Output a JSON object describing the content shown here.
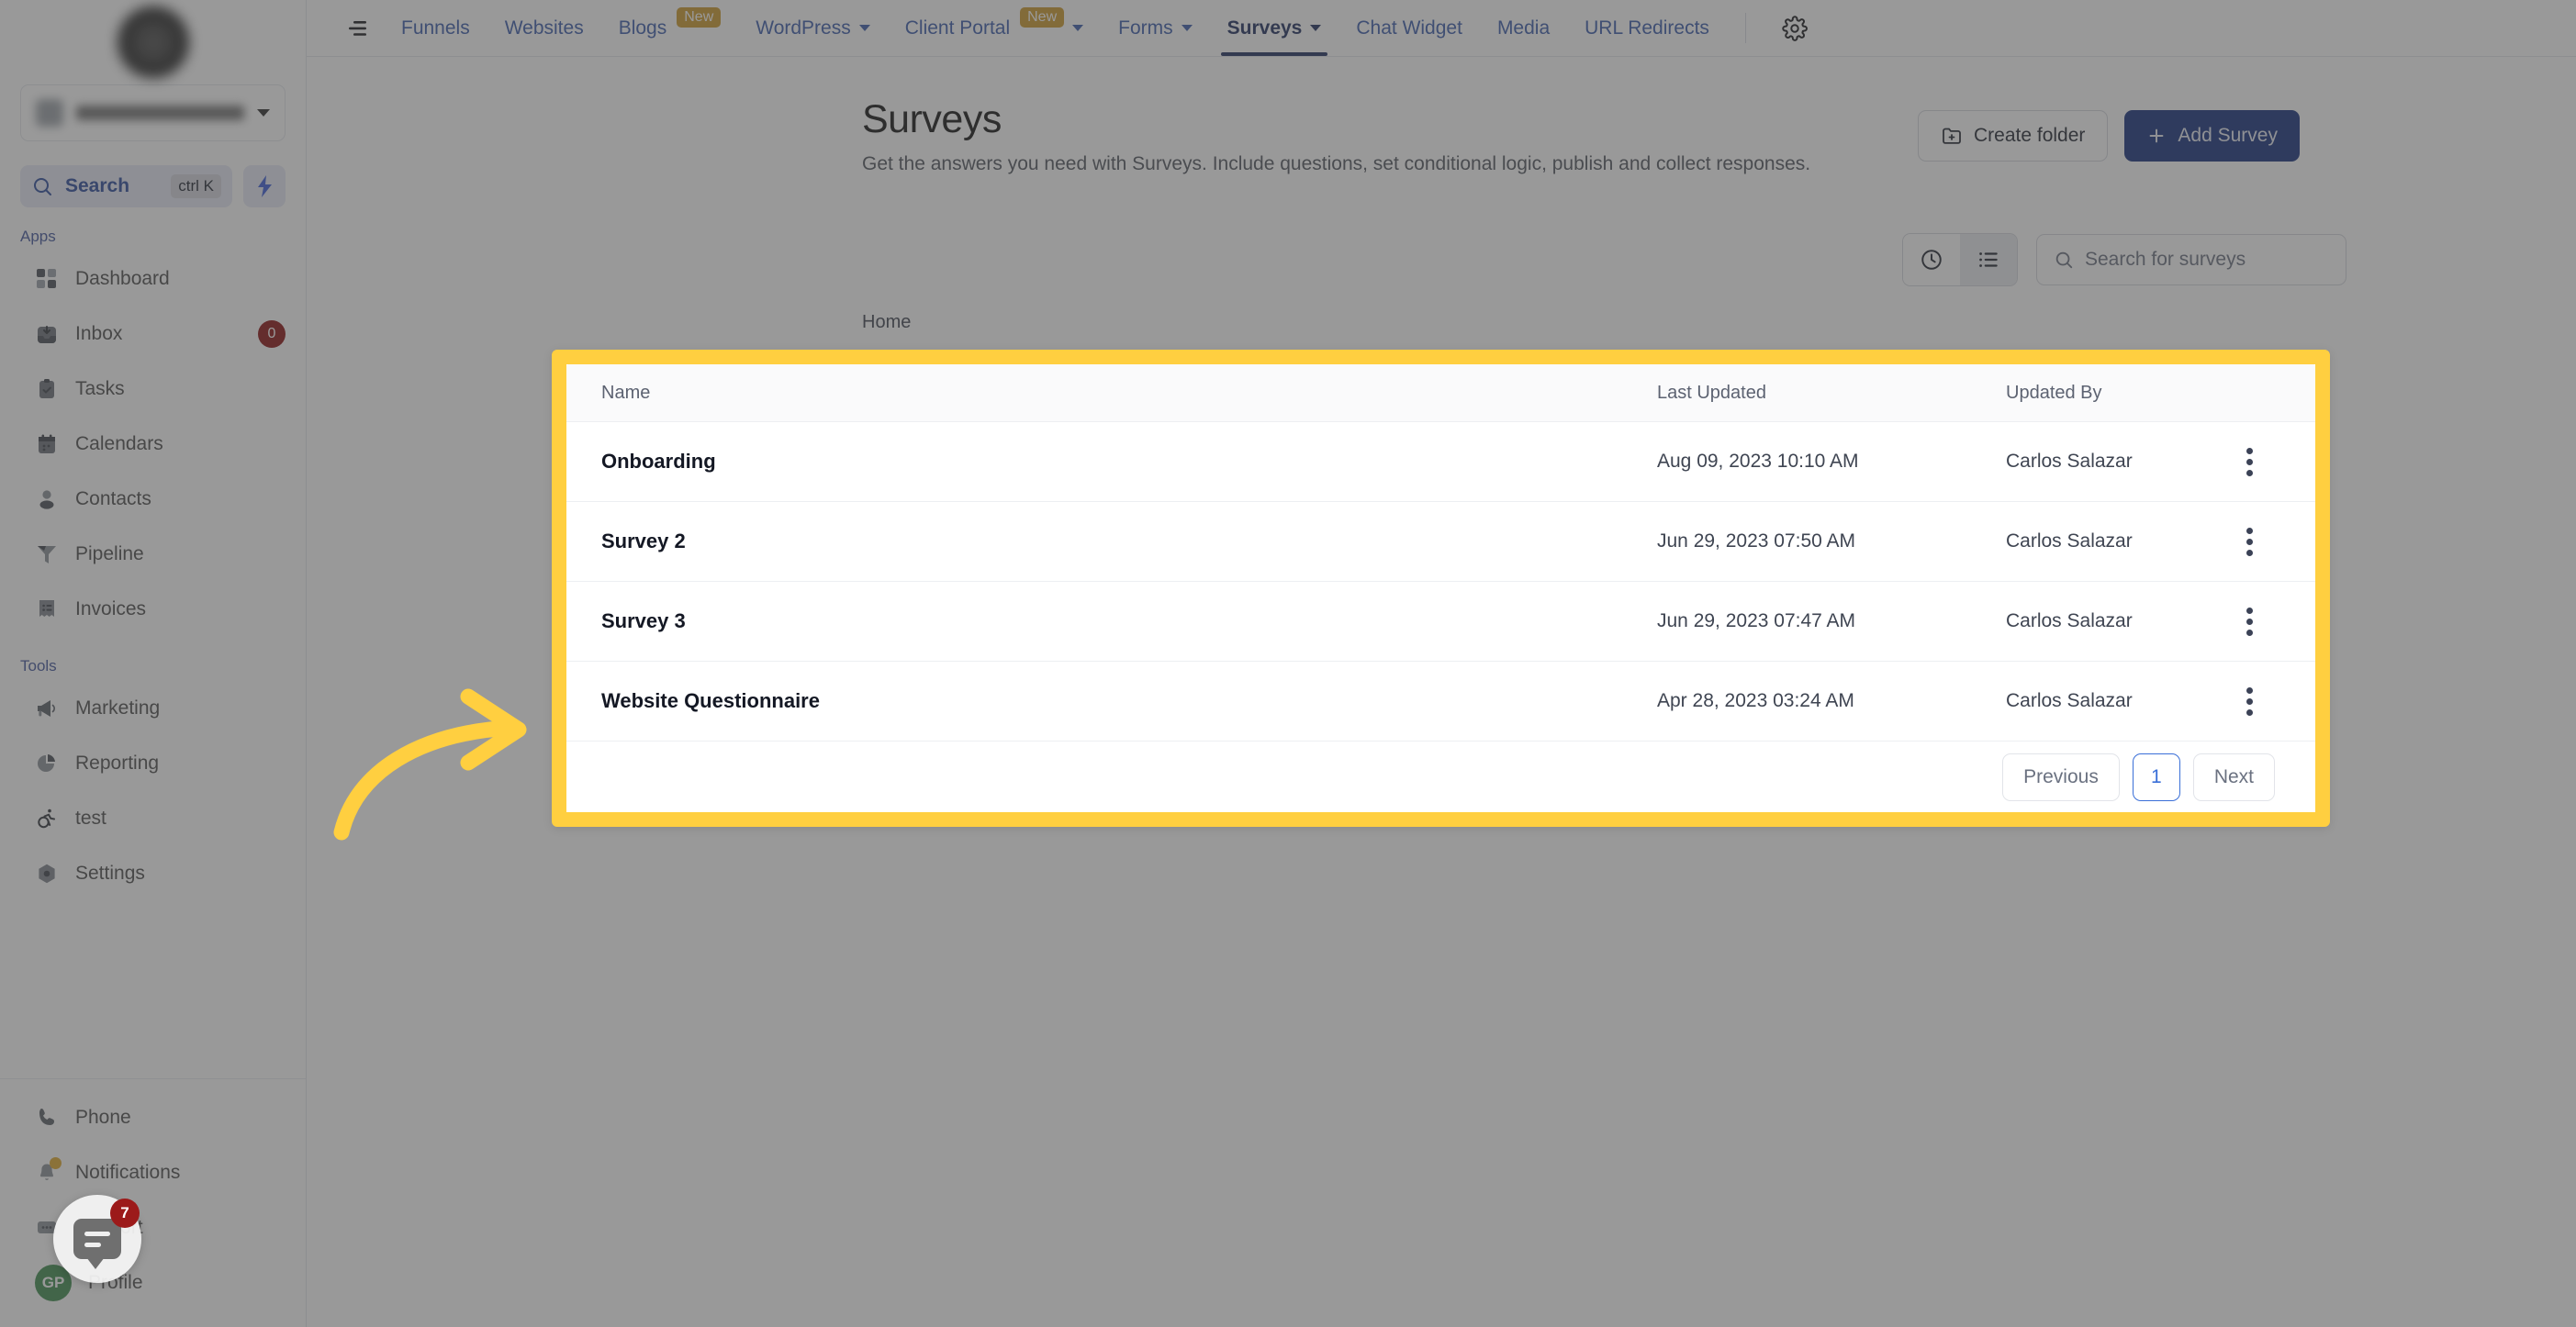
{
  "sidebar": {
    "account": {
      "name": "",
      "chevron_icon": "chevron-down-icon"
    },
    "search": {
      "label": "Search",
      "shortcut": "ctrl K",
      "icon": "search-icon"
    },
    "quick_action_icon": "lightning-bolt-icon",
    "sections": [
      {
        "title": "Apps",
        "items": [
          {
            "label": "Dashboard",
            "icon": "dashboard-grid-icon",
            "badge": null
          },
          {
            "label": "Inbox",
            "icon": "inbox-icon",
            "badge": "0"
          },
          {
            "label": "Tasks",
            "icon": "tasks-clipboard-icon",
            "badge": null
          },
          {
            "label": "Calendars",
            "icon": "calendar-icon",
            "badge": null
          },
          {
            "label": "Contacts",
            "icon": "contacts-person-icon",
            "badge": null
          },
          {
            "label": "Pipeline",
            "icon": "pipeline-funnel-icon",
            "badge": null
          },
          {
            "label": "Invoices",
            "icon": "invoice-list-icon",
            "badge": null
          }
        ]
      },
      {
        "title": "Tools",
        "items": [
          {
            "label": "Marketing",
            "icon": "megaphone-icon",
            "badge": null
          },
          {
            "label": "Reporting",
            "icon": "pie-chart-icon",
            "badge": null
          },
          {
            "label": "test",
            "icon": "accessibility-icon",
            "badge": null
          },
          {
            "label": "Settings",
            "icon": "gear-hexagon-icon",
            "badge": null
          }
        ]
      }
    ],
    "bottom_items": [
      {
        "label": "Phone",
        "icon": "phone-icon"
      },
      {
        "label": "Notifications",
        "icon": "bell-icon"
      },
      {
        "label": "Support",
        "icon": "support-chat-icon"
      },
      {
        "label": "Profile",
        "icon": "avatar-icon",
        "avatar_initials": "GP"
      }
    ]
  },
  "chat_widget": {
    "badge": "7",
    "icon": "chat-bubble-icon"
  },
  "topnav": {
    "collapse_icon": "collapse-menu-icon",
    "settings_icon": "gear-icon",
    "tabs": [
      {
        "label": "Funnels",
        "badge": null,
        "caret": false,
        "active": false
      },
      {
        "label": "Websites",
        "badge": null,
        "caret": false,
        "active": false
      },
      {
        "label": "Blogs",
        "badge": "New",
        "caret": false,
        "active": false
      },
      {
        "label": "WordPress",
        "badge": null,
        "caret": true,
        "active": false
      },
      {
        "label": "Client Portal",
        "badge": "New",
        "caret": true,
        "active": false
      },
      {
        "label": "Forms",
        "badge": null,
        "caret": true,
        "active": false
      },
      {
        "label": "Surveys",
        "badge": null,
        "caret": true,
        "active": true
      },
      {
        "label": "Chat Widget",
        "badge": null,
        "caret": false,
        "active": false
      },
      {
        "label": "Media",
        "badge": null,
        "caret": false,
        "active": false
      },
      {
        "label": "URL Redirects",
        "badge": null,
        "caret": false,
        "active": false
      }
    ]
  },
  "page": {
    "title": "Surveys",
    "subtitle": "Get the answers you need with Surveys. Include questions, set conditional logic, publish and collect responses.",
    "create_folder_label": "Create folder",
    "create_folder_icon": "folder-plus-icon",
    "add_survey_label": "Add Survey",
    "add_survey_icon": "plus-icon",
    "breadcrumb": "Home"
  },
  "toolbar": {
    "recent_view_icon": "clock-icon",
    "list_view_icon": "list-icon",
    "search_placeholder": "Search for surveys",
    "search_value": "",
    "search_icon": "search-icon"
  },
  "table": {
    "columns": [
      "Name",
      "Last Updated",
      "Updated By"
    ],
    "rows": [
      {
        "name": "Onboarding",
        "last_updated": "Aug 09, 2023 10:10 AM",
        "updated_by": "Carlos Salazar",
        "menu_icon": "more-vertical-icon"
      },
      {
        "name": "Survey 2",
        "last_updated": "Jun 29, 2023 07:50 AM",
        "updated_by": "Carlos Salazar",
        "menu_icon": "more-vertical-icon"
      },
      {
        "name": "Survey 3",
        "last_updated": "Jun 29, 2023 07:47 AM",
        "updated_by": "Carlos Salazar",
        "menu_icon": "more-vertical-icon"
      },
      {
        "name": "Website Questionnaire",
        "last_updated": "Apr 28, 2023 03:24 AM",
        "updated_by": "Carlos Salazar",
        "menu_icon": "more-vertical-icon"
      }
    ]
  },
  "pagination": {
    "previous": "Previous",
    "current_page": "1",
    "next": "Next"
  },
  "annotation": {
    "highlight_color": "#FFCF40",
    "arrow_icon": "curved-arrow-right-icon"
  },
  "colors": {
    "accent_blue": "#14307d",
    "link_blue": "#3a5cab",
    "highlight_yellow": "#FFCF40",
    "badge_red": "#9c1a1a",
    "new_badge": "#cc9a2b"
  }
}
